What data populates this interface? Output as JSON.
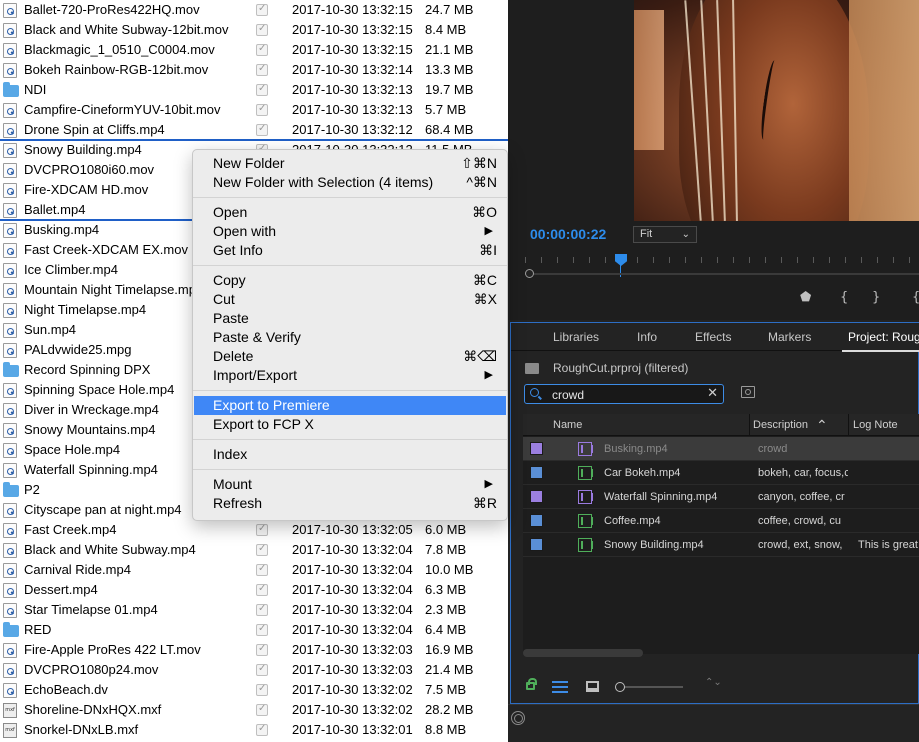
{
  "finder": {
    "rows": [
      {
        "icon": "doc",
        "name": "Ballet-720-ProRes422HQ.mov",
        "date": "2017-10-30 13:32:15",
        "size": "24.7 MB"
      },
      {
        "icon": "doc",
        "name": "Black and White Subway-12bit.mov",
        "date": "2017-10-30 13:32:15",
        "size": "8.4 MB"
      },
      {
        "icon": "doc",
        "name": "Blackmagic_1_0510_C0004.mov",
        "date": "2017-10-30 13:32:15",
        "size": "21.1 MB"
      },
      {
        "icon": "doc",
        "name": "Bokeh Rainbow-RGB-12bit.mov",
        "date": "2017-10-30 13:32:14",
        "size": "13.3 MB"
      },
      {
        "icon": "folder",
        "name": "NDI",
        "date": "2017-10-30 13:32:13",
        "size": "19.7 MB"
      },
      {
        "icon": "doc",
        "name": "Campfire-CineformYUV-10bit.mov",
        "date": "2017-10-30 13:32:13",
        "size": "5.7 MB"
      },
      {
        "icon": "doc",
        "name": "Drone Spin at Cliffs.mp4",
        "date": "2017-10-30 13:32:12",
        "size": "68.4 MB"
      },
      {
        "icon": "doc",
        "name": "Snowy Building.mp4",
        "date": "2017-10-30 13:32:12",
        "size": "11.5 MB"
      },
      {
        "icon": "doc",
        "name": "DVCPRO1080i60.mov",
        "date": "",
        "size": ""
      },
      {
        "icon": "doc",
        "name": "Fire-XDCAM HD.mov",
        "date": "",
        "size": ""
      },
      {
        "icon": "doc",
        "name": "Ballet.mp4",
        "date": "",
        "size": ""
      },
      {
        "icon": "doc",
        "name": "Busking.mp4",
        "date": "",
        "size": ""
      },
      {
        "icon": "doc",
        "name": "Fast Creek-XDCAM EX.mov",
        "date": "",
        "size": ""
      },
      {
        "icon": "doc",
        "name": "Ice Climber.mp4",
        "date": "",
        "size": ""
      },
      {
        "icon": "doc",
        "name": "Mountain Night Timelapse.mp4",
        "date": "",
        "size": ""
      },
      {
        "icon": "doc",
        "name": "Night Timelapse.mp4",
        "date": "",
        "size": ""
      },
      {
        "icon": "doc",
        "name": "Sun.mp4",
        "date": "",
        "size": ""
      },
      {
        "icon": "doc",
        "name": "PALdvwide25.mpg",
        "date": "",
        "size": ""
      },
      {
        "icon": "folder",
        "name": "Record Spinning DPX",
        "date": "",
        "size": ""
      },
      {
        "icon": "doc",
        "name": "Spinning Space Hole.mp4",
        "date": "",
        "size": ""
      },
      {
        "icon": "doc",
        "name": "Diver in Wreckage.mp4",
        "date": "",
        "size": ""
      },
      {
        "icon": "doc",
        "name": "Snowy Mountains.mp4",
        "date": "",
        "size": ""
      },
      {
        "icon": "doc",
        "name": "Space Hole.mp4",
        "date": "",
        "size": ""
      },
      {
        "icon": "doc",
        "name": "Waterfall Spinning.mp4",
        "date": "",
        "size": ""
      },
      {
        "icon": "folder",
        "name": "P2",
        "date": "",
        "size": ""
      },
      {
        "icon": "doc",
        "name": "Cityscape pan at night.mp4",
        "date": "",
        "size": ""
      },
      {
        "icon": "doc",
        "name": "Fast Creek.mp4",
        "date": "2017-10-30 13:32:05",
        "size": "6.0 MB"
      },
      {
        "icon": "doc",
        "name": "Black and White Subway.mp4",
        "date": "2017-10-30 13:32:04",
        "size": "7.8 MB"
      },
      {
        "icon": "doc",
        "name": "Carnival Ride.mp4",
        "date": "2017-10-30 13:32:04",
        "size": "10.0 MB"
      },
      {
        "icon": "doc",
        "name": "Dessert.mp4",
        "date": "2017-10-30 13:32:04",
        "size": "6.3 MB"
      },
      {
        "icon": "doc",
        "name": "Star Timelapse 01.mp4",
        "date": "2017-10-30 13:32:04",
        "size": "2.3 MB"
      },
      {
        "icon": "folder",
        "name": "RED",
        "date": "2017-10-30 13:32:04",
        "size": "6.4 MB"
      },
      {
        "icon": "doc",
        "name": "Fire-Apple ProRes 422 LT.mov",
        "date": "2017-10-30 13:32:03",
        "size": "16.9 MB"
      },
      {
        "icon": "doc",
        "name": "DVCPRO1080p24.mov",
        "date": "2017-10-30 13:32:03",
        "size": "21.4 MB"
      },
      {
        "icon": "doc",
        "name": "EchoBeach.dv",
        "date": "2017-10-30 13:32:02",
        "size": "7.5 MB"
      },
      {
        "icon": "mxf",
        "name": "Shoreline-DNxHQX.mxf",
        "date": "2017-10-30 13:32:02",
        "size": "28.2 MB"
      },
      {
        "icon": "mxf",
        "name": "Snorkel-DNxLB.mxf",
        "date": "2017-10-30 13:32:01",
        "size": "8.8 MB"
      }
    ],
    "mxf_icon_text": "mxf"
  },
  "context_menu": {
    "groups": [
      [
        {
          "label": "New Folder",
          "shortcut": "⇧⌘N"
        },
        {
          "label": "New Folder with Selection (4 items)",
          "shortcut": "^⌘N"
        }
      ],
      [
        {
          "label": "Open",
          "shortcut": "⌘O"
        },
        {
          "label": "Open with",
          "submenu": true
        },
        {
          "label": "Get Info",
          "shortcut": "⌘I"
        }
      ],
      [
        {
          "label": "Copy",
          "shortcut": "⌘C"
        },
        {
          "label": "Cut",
          "shortcut": "⌘X"
        },
        {
          "label": "Paste",
          "shortcut": ""
        },
        {
          "label": "Paste & Verify",
          "shortcut": ""
        },
        {
          "label": "Delete",
          "shortcut": "⌘⌫"
        },
        {
          "label": "Import/Export",
          "submenu": true
        }
      ],
      [
        {
          "label": "Export to Premiere",
          "shortcut": "",
          "highlighted": true
        },
        {
          "label": "Export to FCP X",
          "shortcut": ""
        }
      ],
      [
        {
          "label": "Index",
          "shortcut": ""
        }
      ],
      [
        {
          "label": "Mount",
          "submenu": true
        },
        {
          "label": "Refresh",
          "shortcut": "⌘R"
        }
      ]
    ],
    "submenu_arrow": "▶"
  },
  "premiere": {
    "timecode": "00:00:00:22",
    "fit_label": "Fit",
    "fit_chevron": "⌄",
    "transport_glyphs": [
      "⬟",
      "{",
      "}",
      "{"
    ],
    "tabs": [
      "Libraries",
      "Info",
      "Effects",
      "Markers",
      "Project: Rough"
    ],
    "project_name": "RoughCut.prproj (filtered)",
    "search_value": "crowd",
    "search_clear": "✕",
    "columns": {
      "name": "Name",
      "description": "Description",
      "sort_arrow": "⌃",
      "log_note": "Log Note"
    },
    "items": [
      {
        "name": "Busking.mp4",
        "description": "crowd",
        "log_note": "",
        "label_color": "#9b7fe0",
        "selected": true
      },
      {
        "name": "Car Bokeh.mp4",
        "description": "bokeh, car, focus,c",
        "log_note": "",
        "label_color": "#5a8fd6"
      },
      {
        "name": "Waterfall Spinning.mp4",
        "description": "canyon, coffee, cr",
        "log_note": "",
        "label_color": "#9b7fe0"
      },
      {
        "name": "Coffee.mp4",
        "description": "coffee, crowd, cu",
        "log_note": "",
        "label_color": "#5a8fd6"
      },
      {
        "name": "Snowy Building.mp4",
        "description": "crowd, ext, snow,",
        "log_note": "This is great",
        "label_color": "#5a8fd6"
      }
    ],
    "sort_glyph": "⌃⌄",
    "accent_color": "#2d8ceb"
  }
}
